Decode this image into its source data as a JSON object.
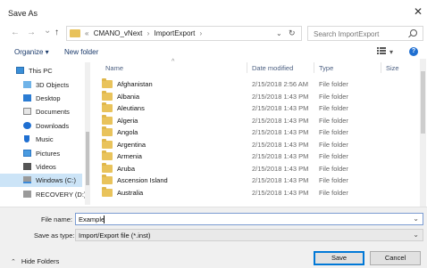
{
  "window": {
    "title": "Save As",
    "close_glyph": "✕"
  },
  "nav": {
    "back_glyph": "←",
    "forward_glyph": "→",
    "recent_glyph": "⌄",
    "up_glyph": "↑",
    "breadcrumb": [
      "«",
      "CMANO_vNext",
      "›",
      "ImportExport",
      "›"
    ],
    "address_dropdown_glyph": "⌄",
    "refresh_glyph": "↻",
    "search_placeholder": "Search ImportExport"
  },
  "toolbar": {
    "organize_label": "Organize ▾",
    "new_folder_label": "New folder",
    "view_dd": "▾",
    "help_glyph": "?"
  },
  "sidebar": {
    "items": [
      {
        "label": "This PC",
        "icon": "computer-icon"
      },
      {
        "label": "3D Objects",
        "icon": "3d-objects-icon"
      },
      {
        "label": "Desktop",
        "icon": "desktop-icon"
      },
      {
        "label": "Documents",
        "icon": "documents-icon"
      },
      {
        "label": "Downloads",
        "icon": "downloads-icon"
      },
      {
        "label": "Music",
        "icon": "music-icon"
      },
      {
        "label": "Pictures",
        "icon": "pictures-icon"
      },
      {
        "label": "Videos",
        "icon": "videos-icon"
      },
      {
        "label": "Windows (C:)",
        "icon": "drive-icon",
        "selected": true
      },
      {
        "label": "RECOVERY (D:)",
        "icon": "drive-icon"
      }
    ]
  },
  "file_list": {
    "columns": {
      "name": "Name",
      "date": "Date modified",
      "type": "Type",
      "size": "Size"
    },
    "sort_glyph": "^",
    "rows": [
      {
        "name": "Afghanistan",
        "date": "2/15/2018 2:56 AM",
        "type": "File folder"
      },
      {
        "name": "Albania",
        "date": "2/15/2018 1:43 PM",
        "type": "File folder"
      },
      {
        "name": "Aleutians",
        "date": "2/15/2018 1:43 PM",
        "type": "File folder"
      },
      {
        "name": "Algeria",
        "date": "2/15/2018 1:43 PM",
        "type": "File folder"
      },
      {
        "name": "Angola",
        "date": "2/15/2018 1:43 PM",
        "type": "File folder"
      },
      {
        "name": "Argentina",
        "date": "2/15/2018 1:43 PM",
        "type": "File folder"
      },
      {
        "name": "Armenia",
        "date": "2/15/2018 1:43 PM",
        "type": "File folder"
      },
      {
        "name": "Aruba",
        "date": "2/15/2018 1:43 PM",
        "type": "File folder"
      },
      {
        "name": "Ascension Island",
        "date": "2/15/2018 1:43 PM",
        "type": "File folder"
      },
      {
        "name": "Australia",
        "date": "2/15/2018 1:43 PM",
        "type": "File folder"
      }
    ]
  },
  "form": {
    "file_name_label": "File name:",
    "file_name_value": "Example",
    "save_as_type_label": "Save as type:",
    "save_as_type_value": "Import/Export file (*.inst)",
    "dropdown_glyph": "⌄",
    "hide_folders_label": "Hide Folders",
    "hide_folders_glyph": "⌃",
    "save_label": "Save",
    "cancel_label": "Cancel"
  },
  "colors": {
    "folder": "#e9c35b",
    "accent": "#0078d7",
    "selection": "#cce4f7"
  }
}
